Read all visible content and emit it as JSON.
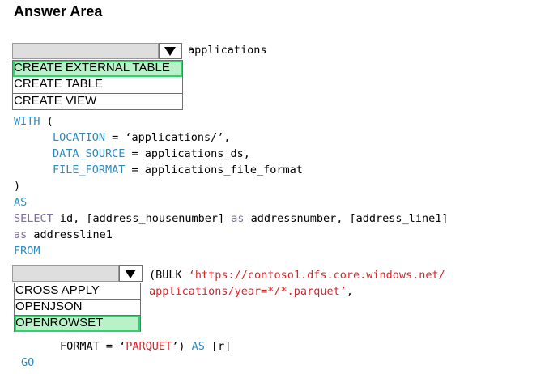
{
  "header": {
    "title": "Answer Area"
  },
  "dropdown1": {
    "options": [
      "CREATE EXTERNAL TABLE",
      "CREATE TABLE",
      "CREATE VIEW"
    ],
    "selected": "CREATE EXTERNAL TABLE",
    "arrow_icon": "triangle-down"
  },
  "dropdown2": {
    "options": [
      "CROSS APPLY",
      "OPENJSON",
      "OPENROWSET"
    ],
    "selected": "OPENROWSET",
    "arrow_icon": "triangle-down"
  },
  "colors": {
    "keyword": "#2e8bbf",
    "function": "#7f6da8",
    "string": "#d9262b",
    "selected_fill": "#b9f2c9",
    "selected_border": "#2fd36b"
  },
  "code": {
    "line0": "applications",
    "with_kw": "WITH",
    "with_paren": " (",
    "location_kw": "LOCATION",
    "location_rest": " = ‘applications/’,",
    "datasource_kw": "DATA_SOURCE",
    "datasource_rest": " = applications_ds,",
    "fileformat_kw": "FILE_FORMAT",
    "fileformat_rest": " = applications_file_format",
    "close_paren": ")",
    "as_kw": "AS",
    "select_kw": "SELECT",
    "select_rest1": " id, [address_housenumber] ",
    "as_inline1": "as",
    "select_rest2": " addressnumber, [address_line1]",
    "as_inline2": "as",
    "select_rest3": " addressline1",
    "from_kw": "FROM",
    "bulk_prefix": "(BULK ",
    "bulk_url1": "‘https://contoso1.dfs.core.windows.net/",
    "bulk_url2": "applications/year=*/*.parquet’",
    "bulk_comma": ",",
    "format_prefix": "FORMAT = ‘",
    "format_value": "PARQUET",
    "format_close": "’) ",
    "as_kw2": "AS",
    "alias": " [r]",
    "go_kw": "GO"
  }
}
